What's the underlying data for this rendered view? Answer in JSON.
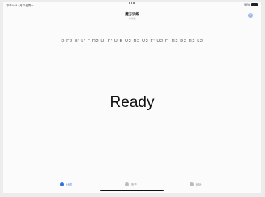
{
  "statusbar": {
    "time": "下午4:54 4月26日周一",
    "battery": "95%"
  },
  "header": {
    "title": "魔方训练",
    "subtitle": "计时器",
    "help_icon": "?"
  },
  "main": {
    "scramble": "D F2 B' L' F R2 U' F' U B U2 R2 U2 F' U2 F' R2 D2 R2 L2",
    "status": "Ready"
  },
  "tabs": [
    {
      "label": "计时",
      "icon": "timer-icon",
      "active": true
    },
    {
      "label": "历史",
      "icon": "history-icon",
      "active": false
    },
    {
      "label": "统计",
      "icon": "stats-icon",
      "active": false
    }
  ],
  "colors": {
    "accent": "#2f6fe0",
    "background": "#fbfbfb"
  }
}
